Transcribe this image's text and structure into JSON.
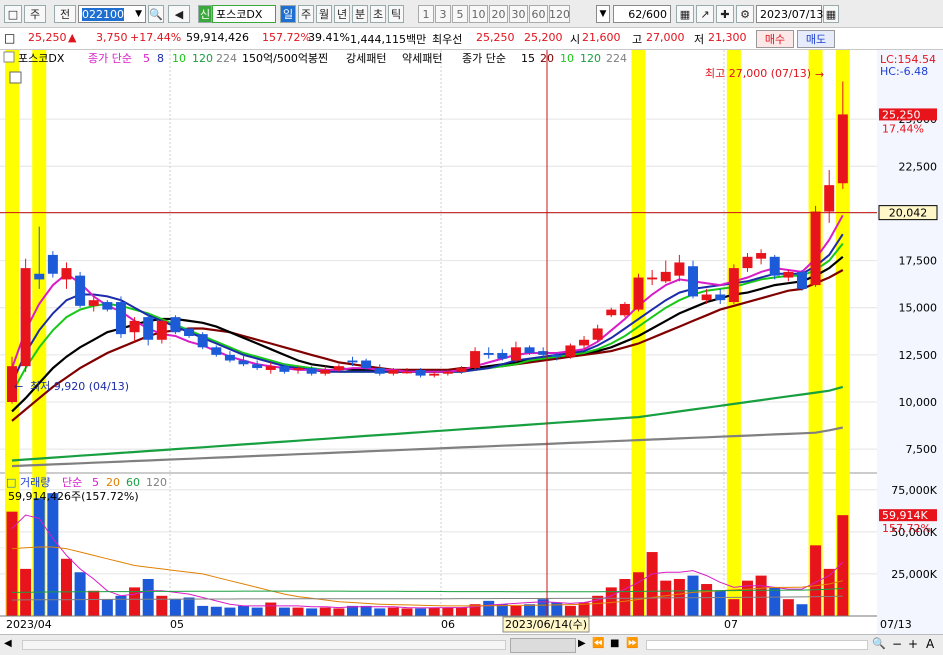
{
  "toolbar": {
    "mode_label": "주",
    "prev_label": "전",
    "code": "022100",
    "new_badge": "신",
    "stock_name": "포스코DX",
    "periods": [
      "일",
      "주",
      "월",
      "년",
      "분",
      "초",
      "틱"
    ],
    "active_period": "일",
    "ticks": [
      "1",
      "3",
      "5",
      "10",
      "20",
      "30",
      "60",
      "120"
    ],
    "count": "62",
    "count_total": "/600",
    "date": "2023/07/13"
  },
  "quote": {
    "price": "25,250",
    "change": "3,750",
    "change_pct": "+17.44%",
    "volume": "59,914,426",
    "volume_ratio": "157.72%",
    "turnover": "39.41%",
    "amount": "1,444,115백만",
    "bid_label": "최우선",
    "ask_price": "25,250",
    "bid_price": "25,200",
    "open_label": "시",
    "open": "21,600",
    "high_label": "고",
    "high": "27,000",
    "low_label": "저",
    "low": "21,300",
    "buy_label": "매수",
    "sell_label": "매도"
  },
  "legend": {
    "name": "포스코DX",
    "ma_label": "종가 단순",
    "ma_periods": [
      "5",
      "8",
      "10",
      "120",
      "224"
    ],
    "pattern_text": "150억/500억봉찐",
    "strong_label": "강세패턴",
    "weak_label": "약세패턴",
    "ma2_label": "종가 단순",
    "ma2_periods": [
      "15",
      "20",
      "10",
      "120",
      "224"
    ],
    "colors": {
      "ma5": "#d81cc8",
      "ma8": "#1c2ca8",
      "ma10": "#18c818",
      "ma120": "#18a040",
      "ma224": "#808080",
      "ma15": "#000000",
      "ma20": "#800000"
    }
  },
  "right_info": {
    "lc": "LC:154.54",
    "hc": "HC:-6.48"
  },
  "price_labels": {
    "current": "25,250",
    "current_pct": "17.44%",
    "crosshair": "20,042",
    "vol_current": "59,914K",
    "vol_pct": "157.72%"
  },
  "annotations": {
    "high": "최고 27,000 (07/13)",
    "low": "최저 9,920 (04/13)"
  },
  "volume_legend": {
    "label": "거래량",
    "ma_label": "단순",
    "periods": [
      "5",
      "20",
      "60",
      "120"
    ],
    "value": "59,914,426주(157.72%)"
  },
  "x_axis": {
    "labels": [
      "2023/04",
      "05",
      "06",
      "07",
      "07/13"
    ],
    "cursor_date": "2023/06/14(수)"
  },
  "chart_data": {
    "type": "candlestick",
    "y_ticks": [
      7500,
      10000,
      12500,
      15000,
      17500,
      20000,
      22500,
      25000
    ],
    "volume_ticks": [
      "25,000K",
      "50,000K",
      "75,000K"
    ],
    "candles": [
      {
        "o": 10000,
        "h": 12400,
        "l": 9920,
        "c": 11900
      },
      {
        "o": 11900,
        "h": 17600,
        "l": 11600,
        "c": 17100
      },
      {
        "o": 16800,
        "h": 19300,
        "l": 16000,
        "c": 16500
      },
      {
        "o": 17800,
        "h": 18000,
        "l": 16600,
        "c": 16800
      },
      {
        "o": 16500,
        "h": 17400,
        "l": 16000,
        "c": 17100
      },
      {
        "o": 16700,
        "h": 16900,
        "l": 15000,
        "c": 15100
      },
      {
        "o": 15100,
        "h": 15600,
        "l": 14800,
        "c": 15400
      },
      {
        "o": 15300,
        "h": 15400,
        "l": 14800,
        "c": 14900
      },
      {
        "o": 15300,
        "h": 15600,
        "l": 13400,
        "c": 13600
      },
      {
        "o": 13700,
        "h": 14500,
        "l": 13200,
        "c": 14300
      },
      {
        "o": 14500,
        "h": 14700,
        "l": 13000,
        "c": 13300
      },
      {
        "o": 13300,
        "h": 14400,
        "l": 13100,
        "c": 14300
      },
      {
        "o": 14500,
        "h": 14600,
        "l": 13600,
        "c": 13700
      },
      {
        "o": 13900,
        "h": 13900,
        "l": 13400,
        "c": 13500
      },
      {
        "o": 13600,
        "h": 13700,
        "l": 12800,
        "c": 12900
      },
      {
        "o": 12900,
        "h": 13000,
        "l": 12400,
        "c": 12500
      },
      {
        "o": 12500,
        "h": 12700,
        "l": 12100,
        "c": 12200
      },
      {
        "o": 12200,
        "h": 12500,
        "l": 11900,
        "c": 12000
      },
      {
        "o": 12000,
        "h": 12200,
        "l": 11700,
        "c": 11800
      },
      {
        "o": 11700,
        "h": 12100,
        "l": 11500,
        "c": 11900
      },
      {
        "o": 11900,
        "h": 12000,
        "l": 11500,
        "c": 11600
      },
      {
        "o": 11700,
        "h": 11900,
        "l": 11500,
        "c": 11800
      },
      {
        "o": 11800,
        "h": 11900,
        "l": 11400,
        "c": 11500
      },
      {
        "o": 11500,
        "h": 11900,
        "l": 11400,
        "c": 11700
      },
      {
        "o": 11700,
        "h": 12000,
        "l": 11600,
        "c": 11900
      },
      {
        "o": 12200,
        "h": 12400,
        "l": 11900,
        "c": 12100
      },
      {
        "o": 12200,
        "h": 12300,
        "l": 11700,
        "c": 11800
      },
      {
        "o": 11800,
        "h": 12000,
        "l": 11400,
        "c": 11500
      },
      {
        "o": 11500,
        "h": 11800,
        "l": 11400,
        "c": 11700
      },
      {
        "o": 11600,
        "h": 11800,
        "l": 11500,
        "c": 11600
      },
      {
        "o": 11700,
        "h": 11800,
        "l": 11300,
        "c": 11400
      },
      {
        "o": 11400,
        "h": 11600,
        "l": 11300,
        "c": 11500
      },
      {
        "o": 11500,
        "h": 11700,
        "l": 11400,
        "c": 11600
      },
      {
        "o": 11600,
        "h": 11900,
        "l": 11500,
        "c": 11800
      },
      {
        "o": 11800,
        "h": 12900,
        "l": 11700,
        "c": 12700
      },
      {
        "o": 12600,
        "h": 12900,
        "l": 12300,
        "c": 12500
      },
      {
        "o": 12600,
        "h": 12800,
        "l": 12200,
        "c": 12300
      },
      {
        "o": 12200,
        "h": 13200,
        "l": 12100,
        "c": 12900
      },
      {
        "o": 12900,
        "h": 13000,
        "l": 12500,
        "c": 12600
      },
      {
        "o": 12700,
        "h": 12900,
        "l": 12400,
        "c": 12500
      },
      {
        "o": 12500,
        "h": 12600,
        "l": 12200,
        "c": 12400
      },
      {
        "o": 12400,
        "h": 13100,
        "l": 12300,
        "c": 13000
      },
      {
        "o": 13000,
        "h": 13500,
        "l": 12800,
        "c": 13300
      },
      {
        "o": 13300,
        "h": 14100,
        "l": 13200,
        "c": 13900
      },
      {
        "o": 14600,
        "h": 15000,
        "l": 14500,
        "c": 14900
      },
      {
        "o": 14600,
        "h": 15300,
        "l": 14500,
        "c": 15200
      },
      {
        "o": 14900,
        "h": 16800,
        "l": 14800,
        "c": 16600
      },
      {
        "o": 16500,
        "h": 17000,
        "l": 16200,
        "c": 16600
      },
      {
        "o": 16400,
        "h": 17500,
        "l": 16300,
        "c": 16900
      },
      {
        "o": 16700,
        "h": 17800,
        "l": 16400,
        "c": 17400
      },
      {
        "o": 17200,
        "h": 17500,
        "l": 15500,
        "c": 15600
      },
      {
        "o": 15400,
        "h": 16000,
        "l": 15200,
        "c": 15700
      },
      {
        "o": 15700,
        "h": 16000,
        "l": 15200,
        "c": 15400
      },
      {
        "o": 15300,
        "h": 17300,
        "l": 15200,
        "c": 17100
      },
      {
        "o": 17100,
        "h": 17900,
        "l": 16900,
        "c": 17700
      },
      {
        "o": 17600,
        "h": 18100,
        "l": 17300,
        "c": 17900
      },
      {
        "o": 17700,
        "h": 17800,
        "l": 16500,
        "c": 16700
      },
      {
        "o": 16600,
        "h": 17000,
        "l": 16400,
        "c": 16900
      },
      {
        "o": 16900,
        "h": 17000,
        "l": 15900,
        "c": 16000
      },
      {
        "o": 16200,
        "h": 20400,
        "l": 16100,
        "c": 20100
      },
      {
        "o": 20100,
        "h": 22300,
        "l": 19500,
        "c": 21500
      },
      {
        "o": 21600,
        "h": 27000,
        "l": 21300,
        "c": 25250
      }
    ],
    "volume": [
      62000,
      28000,
      70000,
      73000,
      34000,
      26000,
      15000,
      10000,
      12000,
      17000,
      22000,
      12000,
      10000,
      11000,
      6000,
      5500,
      5000,
      6000,
      5000,
      8000,
      5000,
      5000,
      4500,
      5000,
      4500,
      6000,
      6000,
      4500,
      5000,
      4500,
      4500,
      5000,
      5000,
      5000,
      7000,
      9000,
      7000,
      6000,
      7000,
      10000,
      8000,
      6000,
      8000,
      12000,
      17000,
      22000,
      26000,
      38000,
      21000,
      22000,
      24000,
      19000,
      15000,
      10000,
      21000,
      24000,
      17000,
      10000,
      7000,
      42000,
      28000,
      59914
    ],
    "highlight_indices": [
      0,
      2,
      46,
      53,
      59,
      61
    ],
    "ma_series": {
      "ma5": [
        11800,
        13800,
        15200,
        16200,
        16800,
        16300,
        15600,
        15100,
        14800,
        14300,
        13900,
        13600,
        13500,
        13200,
        13000,
        12700,
        12400,
        12200,
        12000,
        11900,
        11800,
        11700,
        11700,
        11700,
        11700,
        11800,
        11800,
        11700,
        11700,
        11600,
        11600,
        11600,
        11600,
        11700,
        11900,
        12100,
        12300,
        12500,
        12600,
        12600,
        12600,
        12700,
        12800,
        13200,
        13800,
        14400,
        15100,
        15700,
        16200,
        16500,
        16400,
        16300,
        16200,
        16400,
        16600,
        16900,
        17100,
        17000,
        16900,
        17600,
        18600,
        19900
      ],
      "ma8": [
        11000,
        12600,
        13800,
        14700,
        15400,
        15700,
        15700,
        15600,
        15400,
        15000,
        14600,
        14300,
        14000,
        13700,
        13400,
        13100,
        12800,
        12500,
        12300,
        12100,
        11900,
        11800,
        11700,
        11600,
        11600,
        11600,
        11600,
        11600,
        11600,
        11600,
        11600,
        11600,
        11600,
        11600,
        11700,
        11800,
        12000,
        12200,
        12300,
        12400,
        12500,
        12600,
        12700,
        13000,
        13400,
        13900,
        14400,
        14900,
        15400,
        15800,
        16000,
        16100,
        16200,
        16300,
        16400,
        16600,
        16800,
        16800,
        16800,
        17200,
        17800,
        18900
      ],
      "ma10": [
        10500,
        11800,
        12900,
        13800,
        14500,
        14900,
        15100,
        15200,
        15100,
        14900,
        14700,
        14400,
        14100,
        13800,
        13500,
        13200,
        12900,
        12600,
        12400,
        12200,
        12000,
        11900,
        11800,
        11700,
        11600,
        11600,
        11600,
        11600,
        11600,
        11600,
        11600,
        11600,
        11600,
        11600,
        11700,
        11800,
        11900,
        12000,
        12200,
        12300,
        12400,
        12500,
        12600,
        12800,
        13100,
        13500,
        14000,
        14500,
        15000,
        15400,
        15700,
        15900,
        16000,
        16100,
        16300,
        16500,
        16600,
        16700,
        16700,
        17000,
        17500,
        18400
      ],
      "ma15": [
        9500,
        10200,
        11000,
        11800,
        12400,
        12900,
        13300,
        13700,
        13900,
        14100,
        14300,
        14400,
        14400,
        14300,
        14200,
        14000,
        13700,
        13400,
        13100,
        12800,
        12500,
        12200,
        12000,
        11900,
        11800,
        11700,
        11700,
        11700,
        11600,
        11600,
        11600,
        11600,
        11600,
        11700,
        11800,
        11900,
        12000,
        12100,
        12200,
        12300,
        12400,
        12500,
        12600,
        12700,
        12900,
        13200,
        13500,
        13900,
        14300,
        14700,
        15000,
        15300,
        15500,
        15700,
        15800,
        16000,
        16200,
        16300,
        16400,
        16700,
        17100,
        17700
      ],
      "ma20": [
        9000,
        9600,
        10200,
        10800,
        11300,
        11800,
        12200,
        12600,
        12900,
        13200,
        13500,
        13700,
        13800,
        13900,
        13900,
        13800,
        13700,
        13500,
        13300,
        13100,
        12900,
        12700,
        12500,
        12300,
        12100,
        12000,
        11900,
        11800,
        11700,
        11700,
        11700,
        11700,
        11700,
        11800,
        11800,
        11900,
        11900,
        12000,
        12100,
        12200,
        12300,
        12400,
        12500,
        12600,
        12700,
        12900,
        13100,
        13400,
        13700,
        14000,
        14300,
        14600,
        14900,
        15100,
        15300,
        15500,
        15700,
        15900,
        16000,
        16300,
        16600,
        17000
      ],
      "ma120": [
        6900,
        6950,
        7000,
        7050,
        7100,
        7150,
        7200,
        7250,
        7300,
        7350,
        7400,
        7450,
        7500,
        7550,
        7600,
        7650,
        7700,
        7750,
        7800,
        7850,
        7900,
        7950,
        8000,
        8050,
        8100,
        8150,
        8200,
        8250,
        8300,
        8350,
        8400,
        8450,
        8500,
        8550,
        8600,
        8650,
        8700,
        8750,
        8800,
        8850,
        8900,
        8950,
        9000,
        9050,
        9100,
        9150,
        9200,
        9300,
        9400,
        9500,
        9600,
        9700,
        9800,
        9900,
        10000,
        10100,
        10200,
        10300,
        10400,
        10500,
        10600,
        10800
      ],
      "ma224": [
        6600,
        6630,
        6660,
        6690,
        6720,
        6750,
        6780,
        6810,
        6840,
        6870,
        6900,
        6930,
        6960,
        6990,
        7020,
        7050,
        7080,
        7110,
        7140,
        7170,
        7200,
        7230,
        7260,
        7290,
        7320,
        7350,
        7380,
        7410,
        7440,
        7470,
        7500,
        7530,
        7560,
        7590,
        7620,
        7650,
        7680,
        7710,
        7740,
        7770,
        7800,
        7830,
        7860,
        7890,
        7920,
        7950,
        7980,
        8010,
        8040,
        8070,
        8100,
        8130,
        8160,
        8190,
        8220,
        8250,
        8280,
        8310,
        8340,
        8370,
        8500,
        8650
      ]
    },
    "volume_ma": {
      "ma5": [
        52000,
        60000,
        58000,
        46000,
        36000,
        28000,
        22000,
        15000,
        12000,
        13000,
        15000,
        15000,
        14000,
        13000,
        11000,
        9000,
        7000,
        6000,
        6000,
        6000,
        6000,
        6000,
        5500,
        5500,
        5000,
        5500,
        5500,
        5500,
        5500,
        5000,
        4800,
        4900,
        5000,
        5000,
        5500,
        6500,
        7000,
        7500,
        8000,
        8500,
        8000,
        7500,
        8000,
        9500,
        12000,
        16000,
        20000,
        25000,
        26000,
        26000,
        27000,
        24000,
        20000,
        17000,
        18000,
        18000,
        17000,
        16000,
        16000,
        20000,
        24000,
        32000
      ],
      "ma20": [
        40000,
        40500,
        41000,
        41000,
        40000,
        38000,
        36000,
        34000,
        32000,
        30000,
        29000,
        28000,
        27000,
        26000,
        25000,
        23000,
        21000,
        19000,
        17000,
        15000,
        13000,
        11500,
        10500,
        9500,
        8500,
        8000,
        7500,
        7000,
        6800,
        6600,
        6400,
        6200,
        6000,
        6000,
        6000,
        6100,
        6200,
        6300,
        6400,
        6500,
        6600,
        6800,
        7000,
        7400,
        8000,
        8800,
        9800,
        11000,
        12000,
        13000,
        14000,
        14500,
        15000,
        15500,
        16000,
        16500,
        17000,
        17000,
        17200,
        18000,
        19000,
        21000
      ],
      "ma60": [
        14000,
        14100,
        14200,
        14300,
        14300,
        14400,
        14400,
        14500,
        14500,
        14500,
        14600,
        14600,
        14600,
        14700,
        14700,
        14700,
        14700,
        14800,
        14800,
        14800,
        14800,
        14800,
        14800,
        14800,
        14800,
        14700,
        14700,
        14700,
        14700,
        14600,
        14600,
        14600,
        14500,
        14500,
        14500,
        14500,
        14500,
        14400,
        14400,
        14400,
        14400,
        14400,
        14400,
        14400,
        14500,
        14500,
        14600,
        14700,
        14800,
        14900,
        15000,
        15000,
        15100,
        15100,
        15200,
        15300,
        15300,
        15400,
        15400,
        15600,
        15900,
        16400
      ],
      "ma120": [
        9500,
        9550,
        9600,
        9650,
        9700,
        9750,
        9800,
        9850,
        9900,
        9950,
        10000,
        10000,
        10050,
        10050,
        10100,
        10100,
        10100,
        10150,
        10150,
        10150,
        10200,
        10200,
        10200,
        10200,
        10250,
        10250,
        10250,
        10250,
        10300,
        10300,
        10300,
        10300,
        10300,
        10350,
        10350,
        10350,
        10400,
        10400,
        10400,
        10400,
        10450,
        10450,
        10450,
        10500,
        10500,
        10550,
        10600,
        10700,
        10750,
        10800,
        10900,
        10950,
        11000,
        11050,
        11100,
        11200,
        11250,
        11300,
        11350,
        11500,
        11600,
        11800
      ]
    }
  }
}
